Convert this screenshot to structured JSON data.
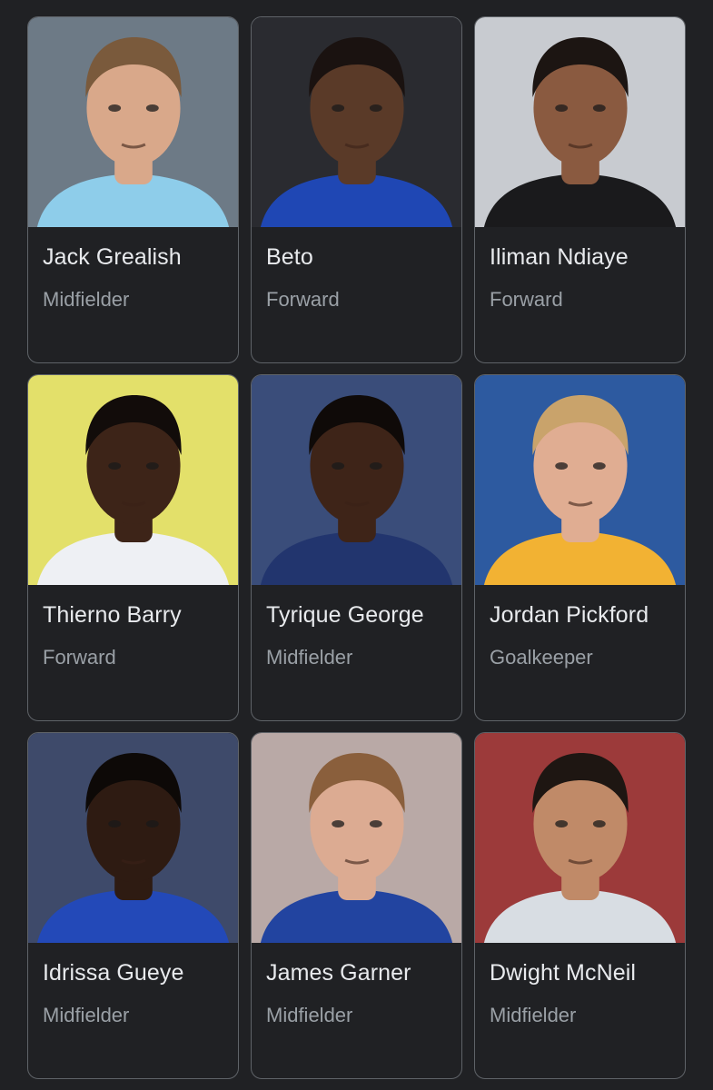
{
  "players": [
    {
      "name": "Jack Grealish",
      "position": "Midfielder",
      "bg": "#6d7a86",
      "skin": "#d9a88a",
      "hair": "#7a5a3c",
      "shirt": "#8ecdea",
      "photo_icon": "player-photo"
    },
    {
      "name": "Beto",
      "position": "Forward",
      "bg": "#2a2b30",
      "skin": "#5a3a28",
      "hair": "#1a1210",
      "shirt": "#1f47b4",
      "photo_icon": "player-photo"
    },
    {
      "name": "Iliman Ndiaye",
      "position": "Forward",
      "bg": "#c8cbd0",
      "skin": "#8a5a40",
      "hair": "#1c1512",
      "shirt": "#1a1a1c",
      "photo_icon": "player-photo"
    },
    {
      "name": "Thierno Barry",
      "position": "Forward",
      "bg": "#e3e06a",
      "skin": "#3d2418",
      "hair": "#120c0a",
      "shirt": "#eef0f4",
      "photo_icon": "player-photo"
    },
    {
      "name": "Tyrique George",
      "position": "Midfielder",
      "bg": "#3a4d7a",
      "skin": "#3e2418",
      "hair": "#0f0a08",
      "shirt": "#22356e",
      "photo_icon": "player-photo"
    },
    {
      "name": "Jordan Pickford",
      "position": "Goalkeeper",
      "bg": "#2d5aa0",
      "skin": "#e0ad92",
      "hair": "#c9a36b",
      "shirt": "#f2b233",
      "photo_icon": "player-photo"
    },
    {
      "name": "Idrissa Gueye",
      "position": "Midfielder",
      "bg": "#3e4a6a",
      "skin": "#2e1b12",
      "hair": "#0d0907",
      "shirt": "#2349b8",
      "photo_icon": "player-photo"
    },
    {
      "name": "James Garner",
      "position": "Midfielder",
      "bg": "#b9a9a6",
      "skin": "#dcab92",
      "hair": "#8a5f3c",
      "shirt": "#2244a0",
      "photo_icon": "player-photo"
    },
    {
      "name": "Dwight McNeil",
      "position": "Midfielder",
      "bg": "#9c3a3a",
      "skin": "#c08a68",
      "hair": "#1e1612",
      "shirt": "#d8dde3",
      "photo_icon": "player-photo"
    }
  ]
}
